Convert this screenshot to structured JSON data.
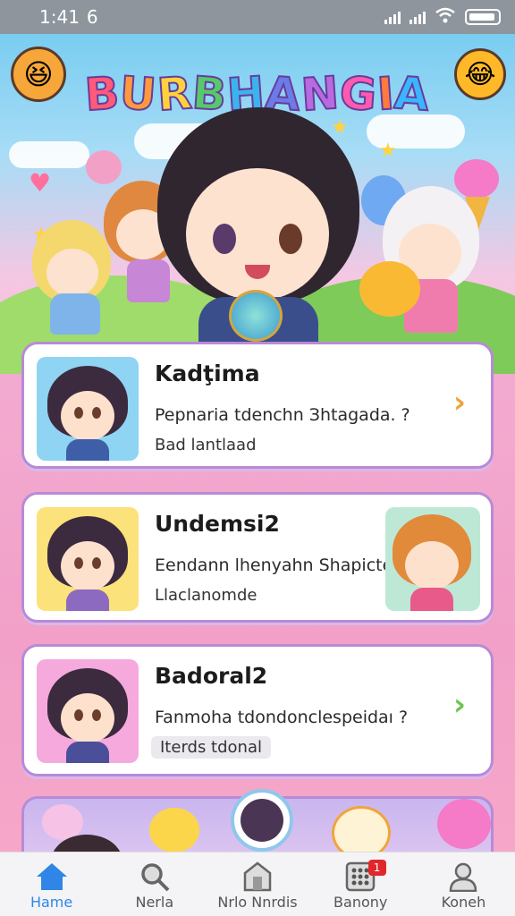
{
  "status_bar": {
    "time": "1:41",
    "notif_glyph": "6",
    "icons": [
      "signal-icon",
      "signal-icon",
      "wifi-icon",
      "battery-icon"
    ]
  },
  "hero": {
    "app_title": "BURBHANGIA",
    "title_colors": [
      "#ff5a7a",
      "#ff9a3c",
      "#ffd23d",
      "#55c96b",
      "#3bb4ee",
      "#6b7be8",
      "#b86be0",
      "#ff5ab0",
      "#ff7a3d",
      "#38b6ff"
    ]
  },
  "cards": [
    {
      "title": "Kadţima",
      "subtitle": "Peрnaria tdenchn Зhtagada. ?",
      "meta": "Bad lantlaad",
      "thumb_bg": "#8fd4f2",
      "chevron_color": "#f0a23a"
    },
    {
      "title": "Undemsi2",
      "subtitle": "Eendann lhenyahn Shapicte",
      "meta": "Llaclanomde",
      "thumb_bg": "#fbe27a",
      "extra_thumb_bg": "#bde8d6"
    },
    {
      "title": "Badoral2",
      "subtitle": "Fanmoha tdondonclеsрeidaı ?",
      "meta": "Iterds tdonal",
      "thumb_bg": "#f5a9dc",
      "chevron_color": "#6bc54a"
    }
  ],
  "bottom_nav": {
    "items": [
      {
        "label": "Hame",
        "icon": "home-icon",
        "active": true
      },
      {
        "label": "Nerla",
        "icon": "search-icon",
        "active": false
      },
      {
        "label": "Nrlo Nnrdis",
        "icon": "store-icon",
        "active": false
      },
      {
        "label": "Banony",
        "icon": "grid-icon",
        "active": false,
        "badge": "1"
      },
      {
        "label": "Koneh",
        "icon": "profile-icon",
        "active": false
      }
    ],
    "active_color": "#2f86e6"
  }
}
